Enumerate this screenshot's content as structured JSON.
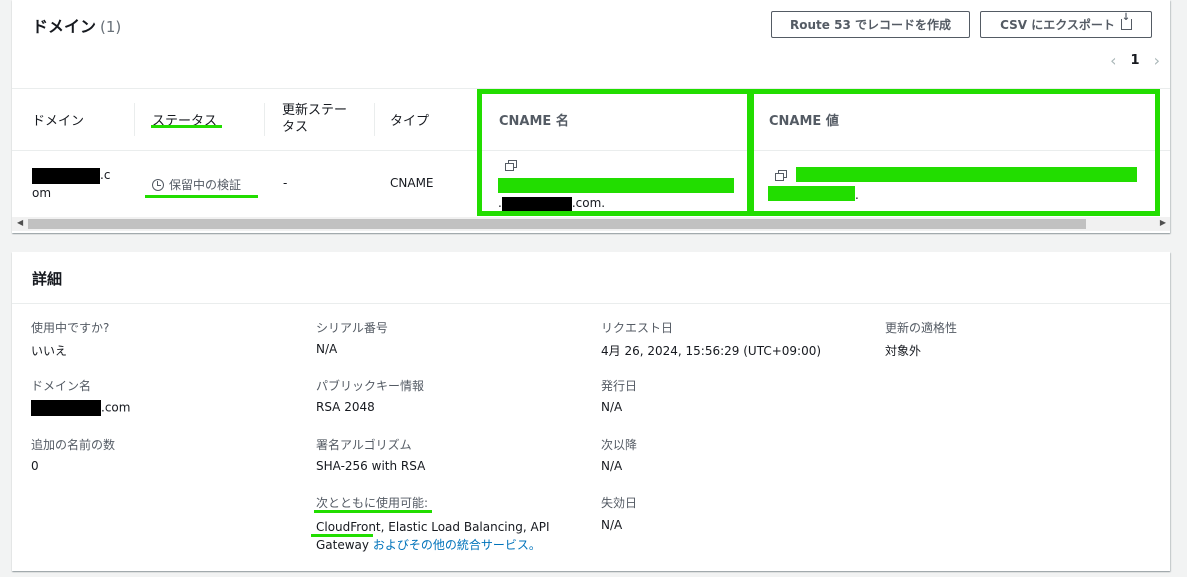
{
  "domains_panel": {
    "title": "ドメイン",
    "count": "(1)",
    "route53_button": "Route 53 でレコードを作成",
    "csv_button": "CSV にエクスポート",
    "pagination": {
      "prev": "‹",
      "page": "1",
      "next": "›"
    },
    "columns": {
      "domain": "ドメイン",
      "status": "ステータス",
      "renewal_status": "更新ステータス",
      "type": "タイプ",
      "cname_name": "CNAME 名",
      "cname_value": "CNAME 値"
    },
    "row": {
      "domain_suffix": ".c",
      "domain_suffix2": "om",
      "status": "保留中の検証",
      "renewal_status": "-",
      "type": "CNAME",
      "cname_name_suffix": ".com.",
      "cname_value_suffix": "."
    }
  },
  "details_panel": {
    "title": "詳細",
    "fields": {
      "in_use_label": "使用中ですか?",
      "in_use_value": "いいえ",
      "domain_name_label": "ドメイン名",
      "domain_name_suffix": ".com",
      "additional_names_label": "追加の名前の数",
      "additional_names_value": "0",
      "serial_label": "シリアル番号",
      "serial_value": "N/A",
      "public_key_label": "パブリックキー情報",
      "public_key_value": "RSA 2048",
      "signature_label": "署名アルゴリズム",
      "signature_value": "SHA-256 with RSA",
      "usable_with_label": "次とともに使用可能:",
      "usable_with_value_line1": "CloudFront, Elastic Load Balancing, API",
      "usable_with_value_line2": "Gateway",
      "usable_with_link": "およびその他の統合サービス。",
      "requested_label": "リクエスト日",
      "requested_value": "4月 26, 2024, 15:56:29 (UTC+09:00)",
      "issued_label": "発行日",
      "issued_value": "N/A",
      "not_before_label": "次以降",
      "not_before_value": "N/A",
      "expires_label": "失効日",
      "expires_value": "N/A",
      "renewal_eligibility_label": "更新の適格性",
      "renewal_eligibility_value": "対象外"
    }
  },
  "colors": {
    "highlight": "#22dd00",
    "redaction": "#000000",
    "link": "#0073bb"
  }
}
